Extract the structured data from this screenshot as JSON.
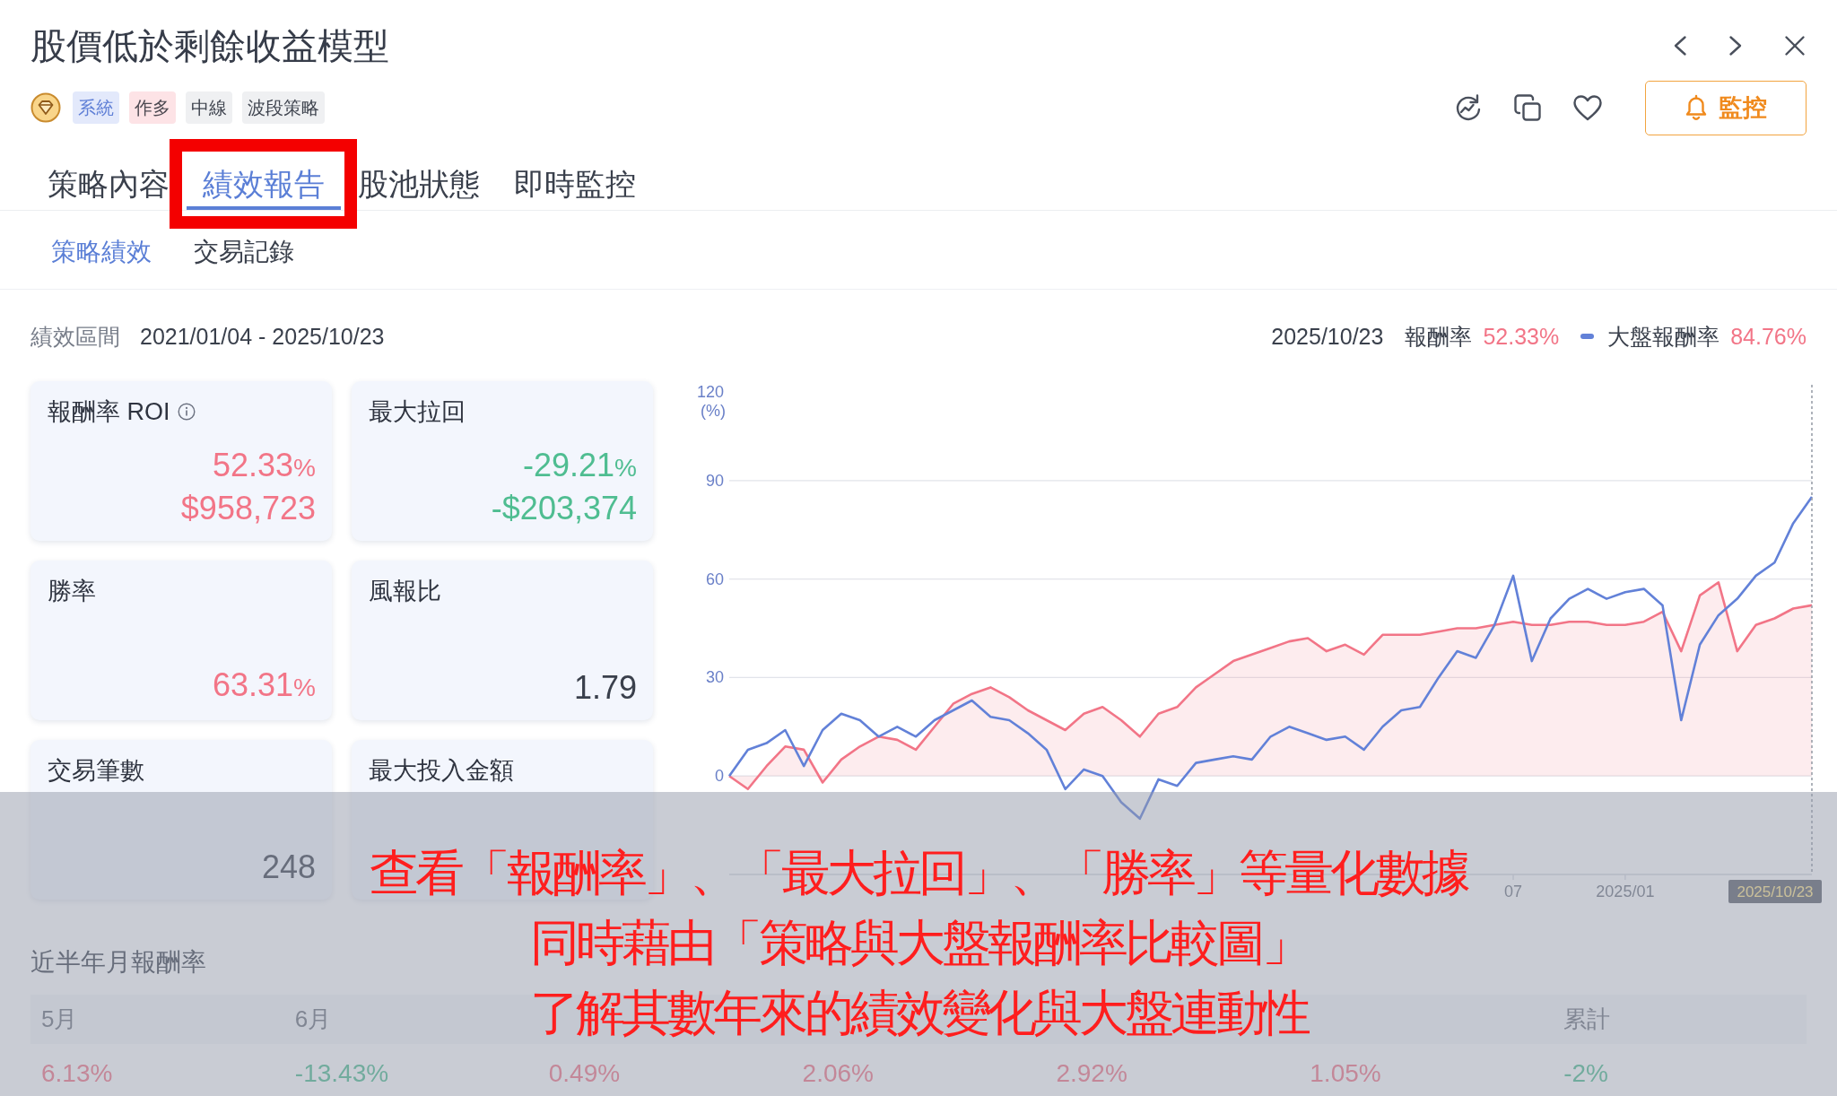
{
  "header": {
    "title": "股價低於剩餘收益模型",
    "tags": [
      {
        "label": "系統",
        "kind": "system"
      },
      {
        "label": "作多",
        "kind": "direction"
      },
      {
        "label": "中線",
        "kind": "plain"
      },
      {
        "label": "波段策略",
        "kind": "plain"
      }
    ],
    "monitor_button": {
      "label": "監控"
    }
  },
  "tabs": [
    {
      "label": "策略內容",
      "selected": false,
      "highlighted": false
    },
    {
      "label": "績效報告",
      "selected": true,
      "highlighted": true
    },
    {
      "label": "股池狀態",
      "selected": false,
      "highlighted": false
    },
    {
      "label": "即時監控",
      "selected": false,
      "highlighted": false
    }
  ],
  "sub_tabs": [
    {
      "label": "策略績效",
      "selected": true
    },
    {
      "label": "交易記錄",
      "selected": false
    }
  ],
  "performance": {
    "period_label": "績效區間",
    "period": "2021/01/04 - 2025/10/23",
    "legend": {
      "date": "2025/10/23",
      "items": [
        {
          "value": "52.33%",
          "kind": "gain",
          "marker": false
        },
        {
          "value": "84.76%",
          "kind": "gain",
          "marker": true
        }
      ]
    },
    "cards": [
      {
        "title": "報酬率 ROI",
        "info": true,
        "values": [
          {
            "number": "52.33",
            "unit": "%",
            "kind": "gain"
          },
          {
            "number": "$958,723",
            "kind": "gain"
          }
        ]
      },
      {
        "title": "最大拉回",
        "info": false,
        "values": [
          {
            "number": "-29.21",
            "unit": "%",
            "kind": "loss"
          },
          {
            "number": "-$203,374",
            "kind": "loss"
          }
        ]
      },
      {
        "title": "勝率",
        "info": false,
        "values": [
          {
            "number": "63.31",
            "unit": "%",
            "kind": "gain"
          }
        ]
      },
      {
        "title": "風報比",
        "info": false,
        "values": [
          {
            "number": "1.79",
            "kind": "plain"
          }
        ]
      },
      {
        "title": "交易筆數",
        "info": false,
        "values": [
          {
            "number": "248",
            "kind": "plain"
          }
        ]
      },
      {
        "title": "最大投入金額",
        "info": false
      }
    ],
    "chart_data": {
      "type": "line",
      "ylabel": "(%)",
      "grid": true,
      "categories": [
        null,
        null,
        null,
        null,
        null,
        null,
        null,
        null,
        null,
        null,
        null,
        null,
        null,
        null,
        null,
        null,
        null,
        null,
        null,
        null,
        null,
        null,
        null,
        null,
        null,
        null,
        null,
        null,
        null,
        null,
        null,
        null,
        null,
        null,
        null,
        null,
        null,
        null,
        null,
        null,
        null,
        null,
        "07",
        null,
        null,
        null,
        null,
        null,
        "2025/01",
        null,
        null,
        null,
        null,
        null,
        null,
        null,
        null,
        null,
        null
      ],
      "ylim": [
        -30,
        120
      ],
      "yticks": [
        0,
        30,
        60,
        90,
        120
      ],
      "series": [
        {
          "name": "報酬率",
          "color": "#f27587",
          "type": "area",
          "values": [
            0,
            -4,
            3,
            9,
            8,
            -2,
            5,
            9,
            12,
            11,
            8,
            15,
            22,
            25,
            27,
            24,
            20,
            17,
            14,
            19,
            21,
            17,
            12,
            19,
            21,
            27,
            31,
            35,
            37,
            39,
            41,
            42,
            38,
            40,
            37,
            43,
            43,
            43,
            44,
            45,
            45,
            46,
            47,
            46,
            46,
            47,
            47,
            46,
            46,
            47,
            50,
            38,
            55,
            59,
            38,
            46,
            48,
            51,
            52
          ]
        },
        {
          "name": "大盤報酬率",
          "color": "#6281d8",
          "type": "line",
          "values": [
            0,
            8,
            10,
            14,
            3,
            14,
            19,
            17,
            12,
            15,
            12,
            17,
            20,
            23,
            18,
            17,
            13,
            8,
            -4,
            2,
            0,
            -8,
            -13,
            -1,
            -3,
            4,
            5,
            6,
            5,
            12,
            15,
            13,
            11,
            12,
            8,
            15,
            20,
            21,
            30,
            38,
            36,
            46,
            61,
            35,
            48,
            54,
            57,
            54,
            56,
            57,
            52,
            17,
            40,
            49,
            54,
            61,
            65,
            77,
            85
          ]
        }
      ]
    },
    "cursor_label": "2025/10/23"
  },
  "monthly_returns": {
    "title": "近半年月報酬率",
    "columns": [
      {
        "header": "5月",
        "value": "6.13%",
        "kind": "gain"
      },
      {
        "header": "6月",
        "value": "-13.43%",
        "kind": "loss"
      },
      {
        "value": "0.49%",
        "kind": "gain"
      },
      {
        "value": "2.06%",
        "kind": "gain"
      },
      {
        "value": "2.92%",
        "kind": "gain"
      },
      {
        "value": "1.05%",
        "kind": "gain"
      },
      {
        "header": "累計",
        "value": "-2%",
        "kind": "loss"
      }
    ]
  },
  "caption": {
    "lines": [
      "查看「報酬率」、「最大拉回」、「勝率」等量化數據",
      "同時藉由「策略與大盤報酬率比較圖」",
      "了解其數年來的績效變化與大盤連動性"
    ]
  }
}
